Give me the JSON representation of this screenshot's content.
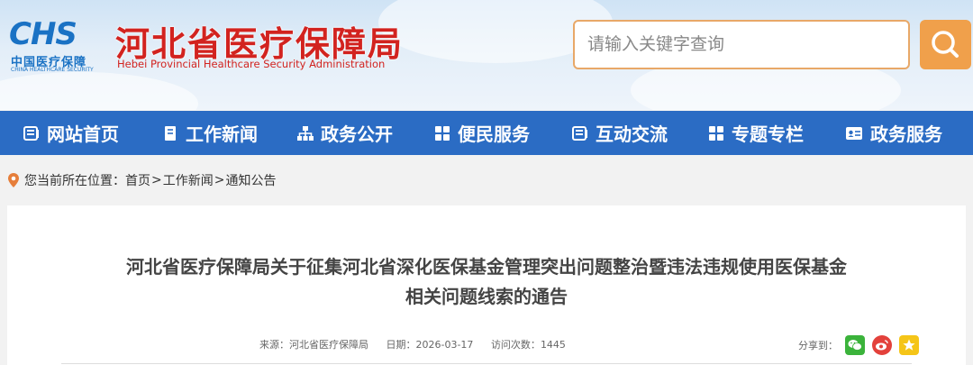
{
  "header": {
    "logo_mark": "CHS",
    "logo_cn": "中国医疗保障",
    "logo_en": "CHINA HEALTHCARE SECURITY",
    "site_title": "河北省医疗保障局",
    "site_subtitle": "Hebei Provincial Healthcare Security Administration",
    "search_placeholder": "请输入关键字查询"
  },
  "nav": {
    "items": [
      {
        "label": "网站首页",
        "icon": "list-icon"
      },
      {
        "label": "工作新闻",
        "icon": "bookmark-icon"
      },
      {
        "label": "政务公开",
        "icon": "sitemap-icon"
      },
      {
        "label": "便民服务",
        "icon": "grid-icon"
      },
      {
        "label": "互动交流",
        "icon": "list-icon"
      },
      {
        "label": "专题专栏",
        "icon": "grid-icon"
      },
      {
        "label": "政务服务",
        "icon": "id-card-icon"
      }
    ]
  },
  "breadcrumb": {
    "prefix": "您当前所在位置：",
    "items": [
      "首页",
      "工作新闻",
      "通知公告"
    ],
    "separator": ">"
  },
  "article": {
    "title_line1": "河北省医疗保障局关于征集河北省深化医保基金管理突出问题整治暨违法违规使用医保基金",
    "title_line2": "相关问题线索的通告",
    "source_label": "来源：",
    "source": "河北省医疗保障局",
    "date_label": "日期：",
    "date": "2026-03-17",
    "views_label": "访问次数：",
    "views": "1445",
    "share_label": "分享到：",
    "share_icons": [
      "wechat-icon",
      "weibo-icon",
      "qzone-icon"
    ]
  },
  "colors": {
    "nav_bg": "#2b6cc4",
    "title_red": "#d2231f",
    "logo_blue": "#1a72c4",
    "search_orange": "#f0a04b"
  }
}
